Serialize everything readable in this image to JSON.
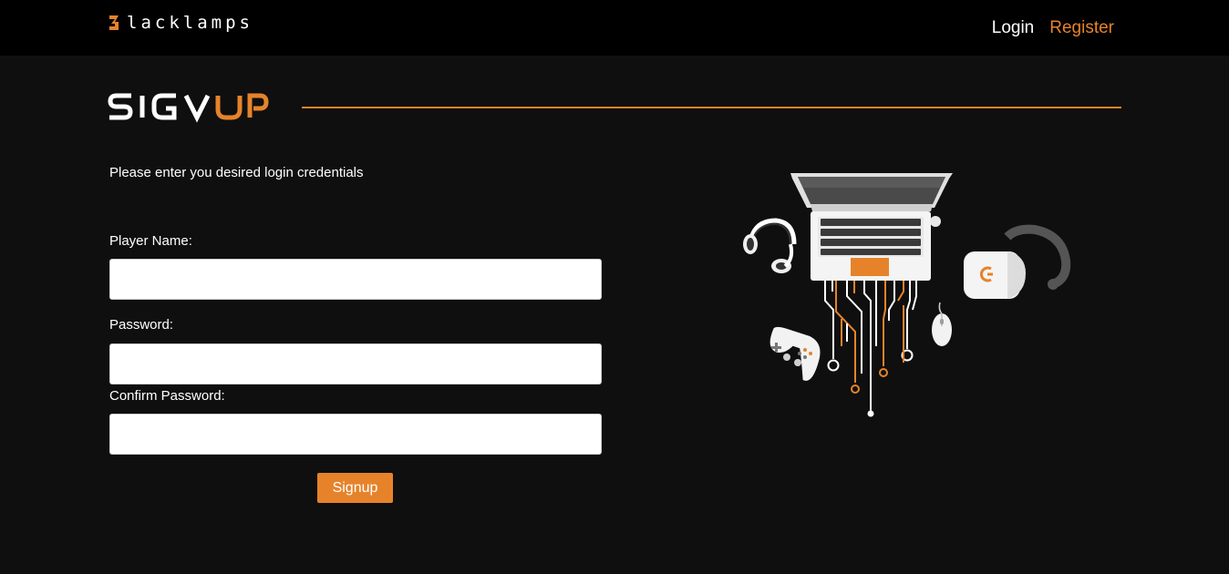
{
  "header": {
    "brand": {
      "logo_letter": "B",
      "name": "lacklamps",
      "icon": "brand-b-icon"
    },
    "nav": {
      "login_label": "Login",
      "register_label": "Register"
    }
  },
  "main": {
    "heading": {
      "text_left": "SIGN",
      "text_right": "UP"
    },
    "intro": "Please enter you desired login credentials",
    "form": {
      "player_name": {
        "label": "Player Name:",
        "value": "",
        "placeholder": ""
      },
      "password": {
        "label": "Password:",
        "value": "",
        "placeholder": ""
      },
      "confirm_password": {
        "label": "Confirm Password:",
        "value": "",
        "placeholder": ""
      },
      "submit_label": "Signup"
    },
    "illustration": {
      "icons": [
        "laptop-icon",
        "headset-icon",
        "vr-headset-icon",
        "gamepad-icon",
        "mouse-icon",
        "circuit-lines"
      ]
    }
  },
  "colors": {
    "accent": "#e6832a",
    "background": "#0f0f0f",
    "header_background": "#000000",
    "text": "#ffffff"
  }
}
